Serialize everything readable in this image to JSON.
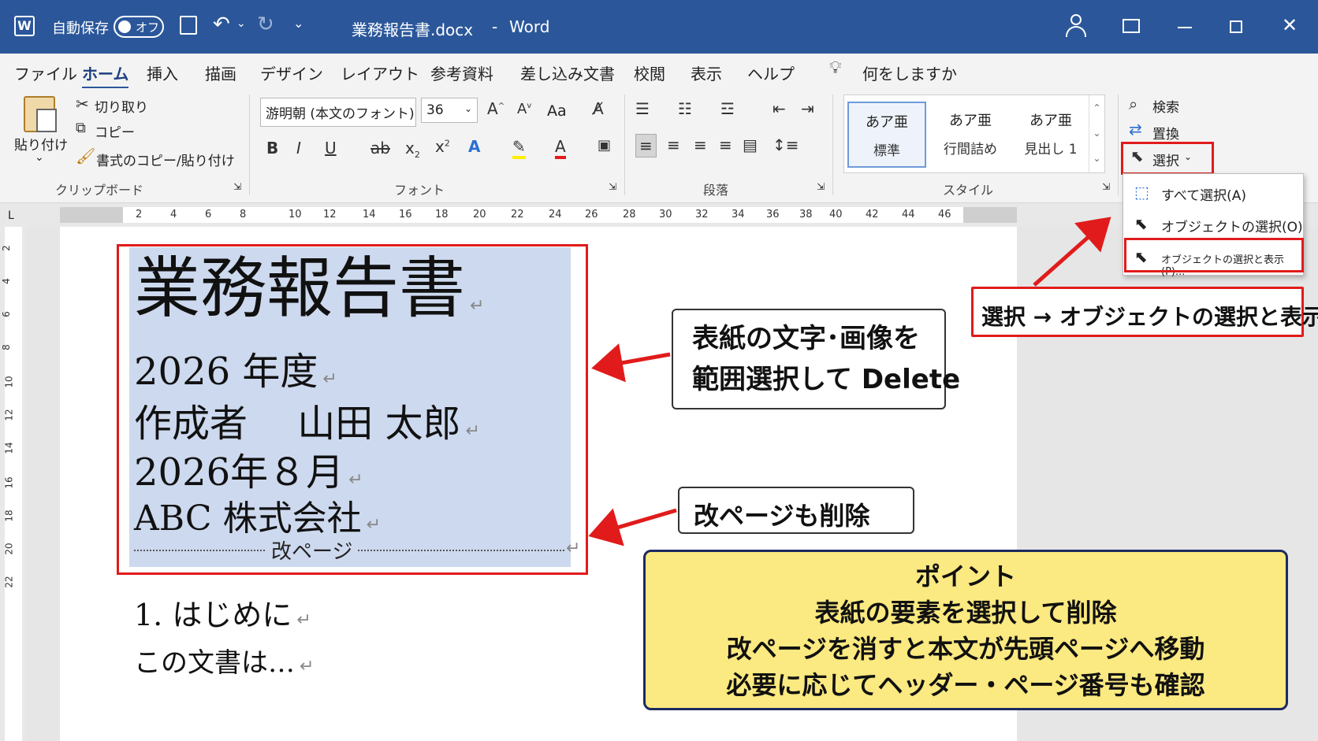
{
  "titlebar": {
    "app_icon": "W",
    "autosave_label": "自動保存",
    "autosave_state": "オフ",
    "save_icon": "save-icon",
    "doc_title": "業務報告書.docx",
    "separator": "-",
    "app_name": "Word"
  },
  "tabs": [
    "ファイル",
    "ホーム",
    "挿入",
    "描画",
    "デザイン",
    "レイアウト",
    "参考資料",
    "差し込み文書",
    "校閲",
    "表示",
    "ヘルプ"
  ],
  "tellme": "何をしますか",
  "ribbon": {
    "clipboard": {
      "paste": "貼り付け",
      "cut": "切り取り",
      "copy": "コピー",
      "format_painter": "書式のコピー/貼り付け",
      "label": "クリップボード"
    },
    "font": {
      "font_name": "游明朝 (本文のフォント)",
      "font_size": "36",
      "aa": "Aa",
      "label": "フォント"
    },
    "paragraph": {
      "label": "段落"
    },
    "styles": {
      "label": "スタイル",
      "items": [
        {
          "sample": "あア亜",
          "name": "標準"
        },
        {
          "sample": "あア亜",
          "name": "行間詰め"
        },
        {
          "sample": "あア亜",
          "name": "見出し 1"
        }
      ]
    },
    "editing": {
      "find": "検索",
      "replace": "置換",
      "select": "選択"
    }
  },
  "select_menu": {
    "items": [
      {
        "label": "すべて選択(A)"
      },
      {
        "label": "オブジェクトの選択(O)"
      },
      {
        "label": "オブジェクトの選択と表示(P)..."
      }
    ]
  },
  "ruler": {
    "h_ticks": [
      "2",
      "4",
      "6",
      "8",
      "10",
      "12",
      "14",
      "16",
      "18",
      "20",
      "22",
      "24",
      "26",
      "28",
      "30",
      "32",
      "34",
      "36",
      "38",
      "40",
      "42",
      "44",
      "46"
    ],
    "v_ticks": [
      "2",
      "4",
      "6",
      "8",
      "10",
      "12",
      "14",
      "16",
      "18",
      "20",
      "22"
    ]
  },
  "document": {
    "title": "業務報告書",
    "year": "2026 年度",
    "author": "作成者　 山田 太郎",
    "date": "2026年８月",
    "company": "ABC 株式会社",
    "page_break": "改ページ",
    "heading": "1.  はじめに",
    "body": "この文書は…",
    "para_mark": "↵"
  },
  "callouts": {
    "cover": [
      "表紙の文字･画像を",
      "範囲選択して Delete"
    ],
    "page_break": "改ページも削除",
    "select_path": "選択 → オブジェクトの選択と表示"
  },
  "point": {
    "title": "ポイント",
    "lines": [
      "表紙の要素を選択して削除",
      "改ページを消すと本文が先頭ページへ移動",
      "必要に応じてヘッダー・ページ番号も確認"
    ]
  },
  "colors": {
    "titlebar": "#2b579a",
    "selection": "#cdd9ee",
    "highlight_red": "#e11b1b",
    "point_bg": "#fbe981",
    "point_border": "#1d2a60"
  }
}
